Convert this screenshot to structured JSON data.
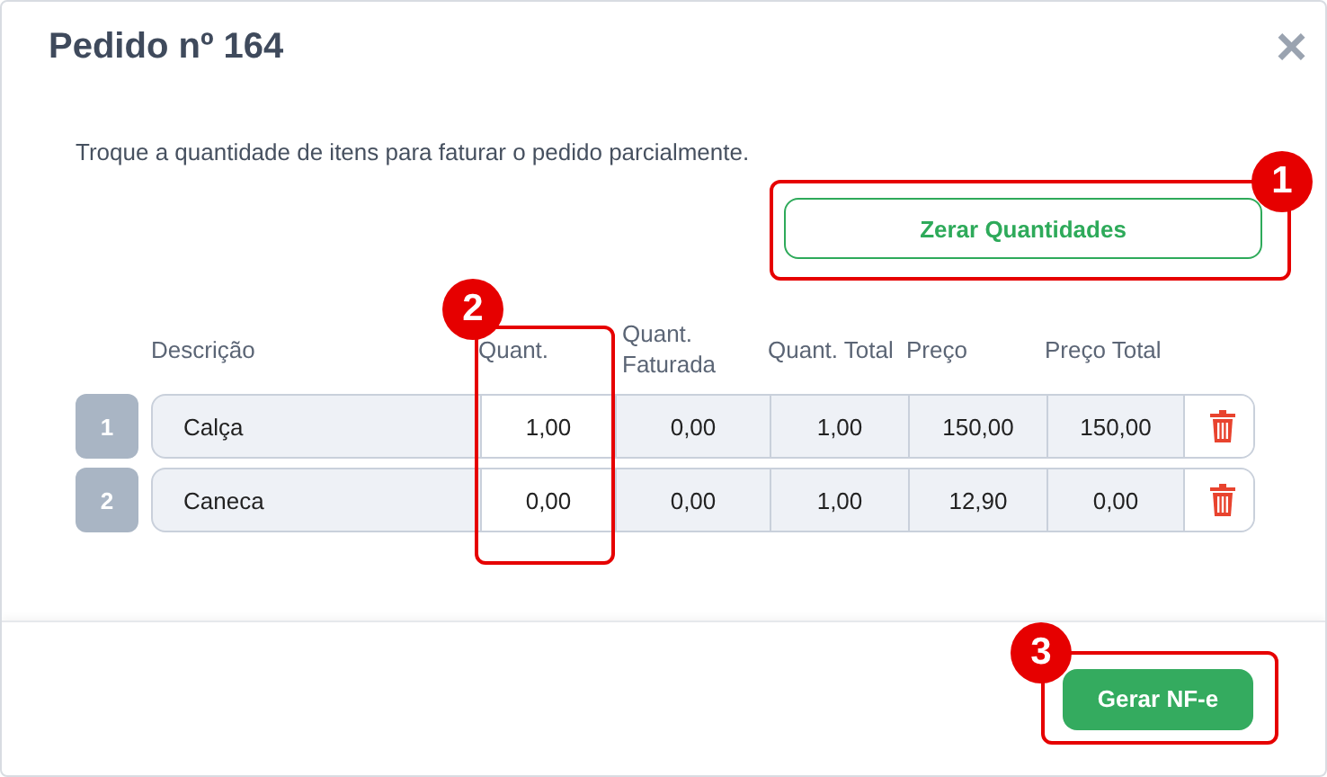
{
  "title": "Pedido nº 164",
  "close": "×",
  "instruction": "Troque a quantidade de itens para faturar o pedido parcialmente.",
  "reset_button": "Zerar Quantidades",
  "columns": [
    "Descrição",
    "Quant.",
    "Quant. Faturada",
    "Quant. Total",
    "Preço",
    "Preço Total"
  ],
  "rows": [
    {
      "index": "1",
      "description": "Calça",
      "quantity": "1,00",
      "invoiced": "0,00",
      "total_quantity": "1,00",
      "price": "150,00",
      "total_price": "150,00"
    },
    {
      "index": "2",
      "description": "Caneca",
      "quantity": "0,00",
      "invoiced": "0,00",
      "total_quantity": "1,00",
      "price": "12,90",
      "total_price": "0,00"
    }
  ],
  "submit_button": "Gerar NF-e",
  "annotations": [
    {
      "number": "1"
    },
    {
      "number": "2"
    },
    {
      "number": "3"
    }
  ]
}
